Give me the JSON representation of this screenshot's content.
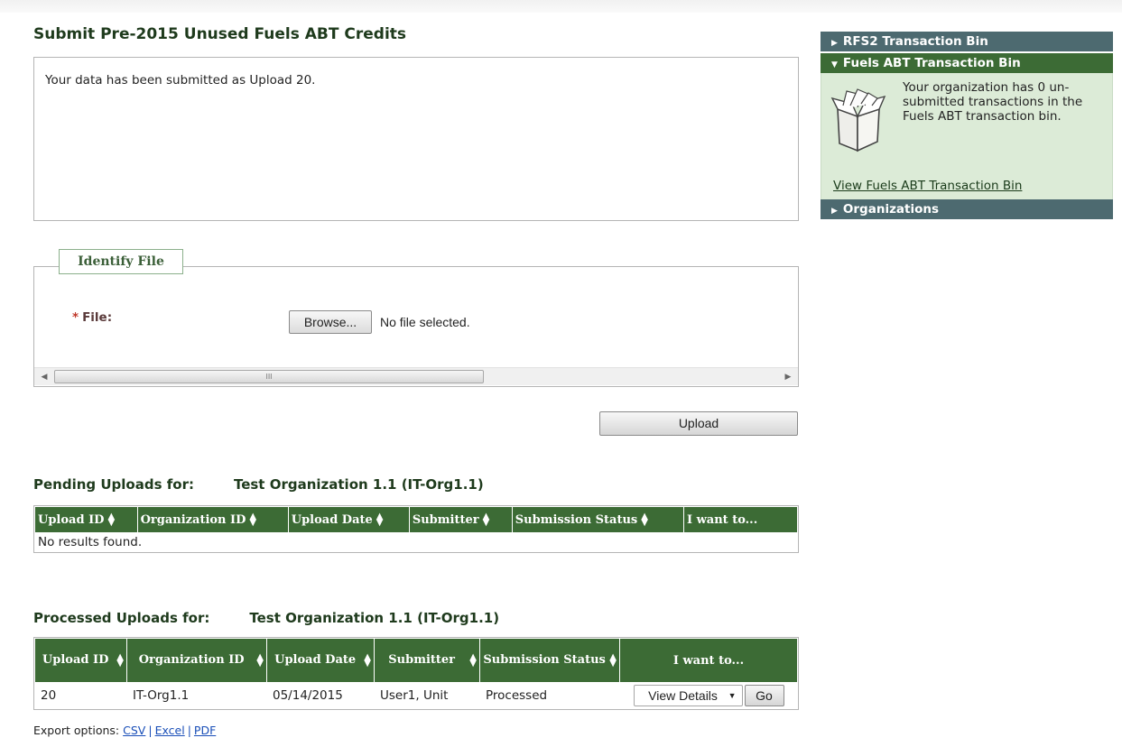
{
  "page": {
    "title": "Submit Pre-2015 Unused Fuels ABT Credits",
    "message": "Your data has been submitted as Upload 20."
  },
  "identify_file": {
    "legend": "Identify File",
    "required_marker": "*",
    "file_label": "File:",
    "browse_label": "Browse...",
    "no_file_text": "No file selected.",
    "scroll_thumb_glyph": "III"
  },
  "upload_button": "Upload",
  "pending": {
    "heading": "Pending Uploads for:",
    "org": "Test Organization 1.1 (IT-Org1.1)",
    "columns": [
      "Upload ID",
      "Organization ID",
      "Upload Date",
      "Submitter",
      "Submission Status",
      "I want to..."
    ],
    "empty_text": "No results found."
  },
  "processed": {
    "heading": "Processed Uploads for:",
    "org": "Test Organization 1.1 (IT-Org1.1)",
    "columns": [
      "Upload ID",
      "Organization ID",
      "Upload Date",
      "Submitter",
      "Submission Status",
      "I want to..."
    ],
    "rows": [
      {
        "upload_id": "20",
        "organization_id": "IT-Org1.1",
        "upload_date": "05/14/2015",
        "submitter": "User1, Unit",
        "status": "Processed",
        "action": "View Details",
        "go_label": "Go"
      }
    ]
  },
  "export": {
    "label": "Export options:",
    "options": [
      "CSV",
      "Excel",
      "PDF"
    ],
    "separator": "|"
  },
  "sidebar": {
    "rfs2_label": "RFS2 Transaction Bin",
    "fuels_label": "Fuels ABT Transaction Bin",
    "fuels_message": "Your organization has 0 un-submitted transactions in the Fuels ABT transaction bin.",
    "fuels_link": "View Fuels ABT Transaction Bin",
    "orgs_label": "Organizations"
  },
  "colors": {
    "header_green": "#3c6b35",
    "sidebar_gray": "#4d6a70",
    "sidebar_body": "#dcebd7",
    "title_text": "#1e3a1c",
    "link_blue": "#1a4fb8"
  }
}
